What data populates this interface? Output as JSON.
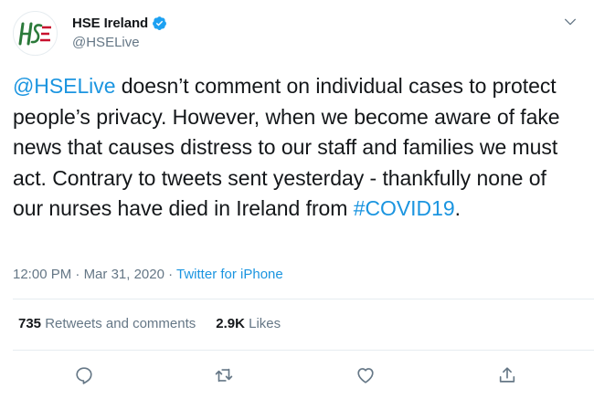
{
  "author": {
    "display_name": "HSE Ireland",
    "handle": "@HSELive",
    "verified": true,
    "avatar": "hse-logo"
  },
  "tweet": {
    "segments": [
      {
        "text": "@HSELive",
        "type": "mention"
      },
      {
        "text": " doesn’t comment on individual cases to protect people’s privacy. However, when we become aware of fake news that causes distress to our staff and families we must act. Contrary to tweets sent yesterday - thankfully none of our nurses have died in Ireland from ",
        "type": "text"
      },
      {
        "text": "#COVID19",
        "type": "hashtag"
      },
      {
        "text": ".",
        "type": "text"
      }
    ]
  },
  "meta": {
    "time": "12:00 PM",
    "separator1": " · ",
    "date": "Mar 31, 2020",
    "separator2": " · ",
    "source": "Twitter for iPhone"
  },
  "stats": {
    "retweets_count": "735",
    "retweets_label": " Retweets and comments",
    "likes_count": "2.9K",
    "likes_label": " Likes"
  },
  "icons": {
    "reply": "reply-icon",
    "retweet": "retweet-icon",
    "like": "heart-icon",
    "share": "share-icon",
    "caret": "chevron-down-icon",
    "verified": "verified-badge-icon"
  },
  "colors": {
    "link": "#1b95e0",
    "secondary": "#657786",
    "primary_text": "#14171a",
    "verified": "#1da1f2",
    "logo_green": "#2b7a3a",
    "logo_red": "#c8102e"
  }
}
